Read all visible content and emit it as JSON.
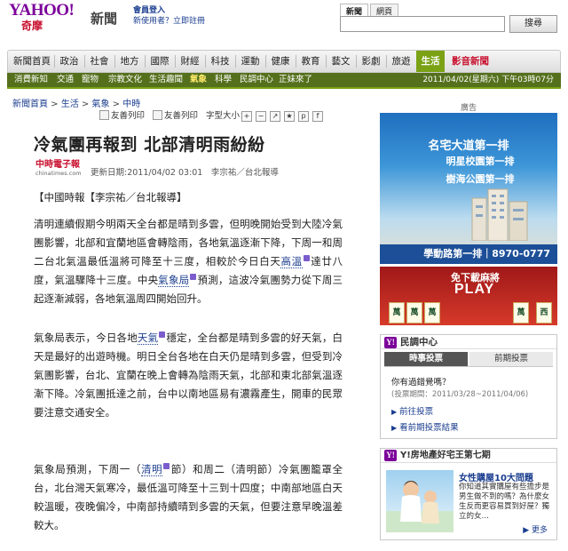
{
  "header": {
    "logo_text": "YAHOO!",
    "logo_sub": "奇摩",
    "section": "新聞",
    "member_login": "會員登入",
    "member_new": "新使用者？立即註冊",
    "search_tabs": [
      "新聞",
      "網頁"
    ],
    "search_value": "",
    "search_button": "搜尋"
  },
  "nav": {
    "items": [
      {
        "label": "新聞首頁"
      },
      {
        "label": "政治"
      },
      {
        "label": "社會"
      },
      {
        "label": "地方"
      },
      {
        "label": "國際"
      },
      {
        "label": "財經"
      },
      {
        "label": "科技"
      },
      {
        "label": "運動"
      },
      {
        "label": "健康"
      },
      {
        "label": "教育"
      },
      {
        "label": "藝文"
      },
      {
        "label": "影劇"
      },
      {
        "label": "旅遊"
      },
      {
        "label": "生活"
      },
      {
        "label": "影音新聞"
      }
    ],
    "active": "生活",
    "colors": {
      "active": "#7aa214",
      "subnav": "#55701c",
      "hot": "#c8102e"
    }
  },
  "subnav": {
    "items": [
      "消費新知",
      "交通",
      "寵物",
      "宗教文化",
      "生活趣聞",
      "氣象",
      "科學",
      "民調中心",
      "正妹來了"
    ],
    "active": "氣象",
    "date": "2011/04/02(星期六) 下午03時07分"
  },
  "breadcrumb": [
    "新聞首頁",
    "生活",
    "氣象",
    "中時"
  ],
  "toolbar": {
    "print": "友善列印",
    "email": "友善列印",
    "font_size": "字型大小："
  },
  "article": {
    "headline": "冷氣團再報到 北部清明雨紛紛",
    "source_name": "中時電子報",
    "source_url": "chinatimes.com",
    "meta": "更新日期:2011/04/02 03:01　李宗祐／台北報導",
    "dateline": "【中國時報【李宗祐／台北報導】",
    "p1_before": "清明連續假期今明兩天全台都是晴到多雲，但明晚開始受到大陸冷氣團影響，北部和宜蘭地區會轉陰雨，各地氣溫逐漸下降，下周一和周二台北氣溫最低溫將可降至十三度，相較於今日白天",
    "p1_kw1": "高溫",
    "p1_mid": "達廿八度，氣溫驟降十三度。中央",
    "p1_kw2": "氣象局",
    "p1_after": "預測，這波冷氣團勢力從下周三起逐漸減弱，各地氣溫周四開始回升。",
    "p2_before": "氣象局表示，今日各地",
    "p2_kw1": "天氣",
    "p2_after": "穩定，全台都是晴到多雲的好天氣，白天是最好的出遊時機。明日全台各地在白天仍是晴到多雲，但受到冷氣團影響，台北、宜蘭在晚上會轉為陰雨天氣，北部和東北部氣溫逐漸下降。冷氣團抵達之前，台中以南地區易有濃霧產生，開車的民眾要注意交通安全。",
    "p3_before": "氣象局預測，下周一（",
    "p3_kw1": "清明",
    "p3_after": "節）和周二（清明節）冷氣團籠罩全台，北台灣天氣寒冷，最低溫可降至十三到十四度；中南部地區白天較溫暖，夜晚偏冷，中南部持續晴到多雲的天氣，但要注意早晚溫差較大。"
  },
  "ad": {
    "label": "廣告",
    "line1": "名宅大道第一排",
    "line2": "明星校園第一排",
    "line3": "樹海公園第一排",
    "footer": "學動路第一排｜8970-0777"
  },
  "game_ad": {
    "download": "免下載麻將",
    "play": "PLAY",
    "tiles": [
      "萬",
      "萬",
      "萬",
      "萬",
      "西"
    ]
  },
  "poll": {
    "title": "民調中心",
    "tab_current": "時事投票",
    "tab_past": "前期投票",
    "question": "你有過錯覺嗎？",
    "period": "(投票期間：2011/03/28~2011/04/06)",
    "link_vote": "前往投票",
    "link_results": "看前期投票結果"
  },
  "promo": {
    "title": "Y!房地產好宅王第七期",
    "headline": "女性購屋10大問題",
    "desc": "你知道其實購屋有些擔步是男生做不到的嗎？為什麼女生反而更容易買到好屋？獨立的女…",
    "more": "更多"
  }
}
